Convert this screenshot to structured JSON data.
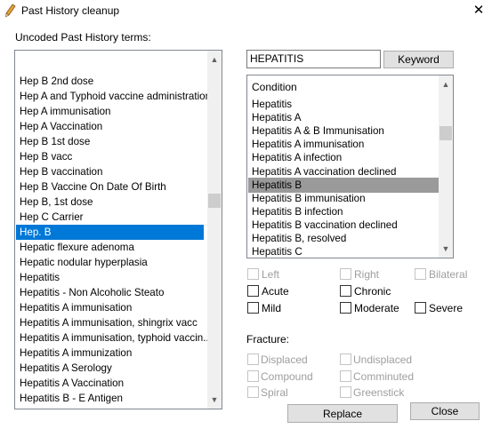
{
  "window": {
    "title": "Past History cleanup",
    "close_glyph": "✕",
    "icon": "pencil-icon"
  },
  "left": {
    "label": "Uncoded Past History terms:",
    "items": [
      "Hep  B 2nd dose",
      "Hep A and Typhoid vaccine administration",
      "Hep A immunisation",
      "Hep A Vaccination",
      "Hep B 1st dose",
      "Hep B vacc",
      "Hep B vaccination",
      "Hep B Vaccine On Date Of Birth",
      "Hep B, 1st dose",
      "Hep C Carrier",
      "Hep. B",
      "Hepatic flexure adenoma",
      "Hepatic nodular hyperplasia",
      "Hepatitis",
      "Hepatitis - Non Alcoholic Steato",
      "Hepatitis A immunisation",
      "Hepatitis A immunisation, shingrix vacc",
      "Hepatitis A immunisation, typhoid vaccin...",
      "Hepatitis A immunization",
      "Hepatitis A Serology",
      "Hepatitis A Vaccination",
      "Hepatitis B - E Antigen"
    ],
    "selected": "Hep. B"
  },
  "search": {
    "value": "HEPATITIS",
    "button_label": "Keyword"
  },
  "conditions": {
    "header": "Condition",
    "items": [
      "Hepatitis",
      "Hepatitis A",
      "Hepatitis A & B Immunisation",
      "Hepatitis A immunisation",
      "Hepatitis A infection",
      "Hepatitis A vaccination declined",
      "Hepatitis B",
      "Hepatitis B immunisation",
      "Hepatitis B infection",
      "Hepatitis B vaccination declined",
      "Hepatitis B, resolved",
      "Hepatitis C"
    ],
    "selected": "Hepatitis B"
  },
  "modifiers": {
    "left": "Left",
    "right": "Right",
    "bilateral": "Bilateral",
    "acute": "Acute",
    "chronic": "Chronic",
    "mild": "Mild",
    "moderate": "Moderate",
    "severe": "Severe"
  },
  "fracture": {
    "label": "Fracture:",
    "displaced": "Displaced",
    "undisplaced": "Undisplaced",
    "compound": "Compound",
    "comminuted": "Comminuted",
    "spiral": "Spiral",
    "greenstick": "Greenstick"
  },
  "buttons": {
    "replace": "Replace",
    "close": "Close"
  },
  "scroll_arrows": {
    "up": "▲",
    "down": "▼"
  }
}
